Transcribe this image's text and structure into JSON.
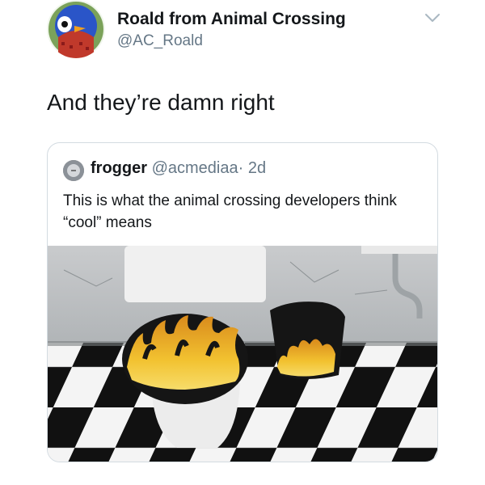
{
  "tweet": {
    "display_name": "Roald from Animal Crossing",
    "handle": "@AC_Roald",
    "text": "And they’re damn right",
    "avatar_icon": "penguin-avatar-icon",
    "menu_icon": "chevron-down-icon"
  },
  "quoted_tweet": {
    "display_name": "frogger",
    "handle": "@acmediaa",
    "separator": "·",
    "time": "2d",
    "text": "This is what the animal crossing developers think “cool” means",
    "media_description": "photo"
  },
  "colors": {
    "text_primary": "#14171a",
    "text_secondary": "#657786",
    "card_border": "#d3dbe1",
    "flame_yellow": "#f2c230",
    "flame_orange": "#d98a1c"
  }
}
